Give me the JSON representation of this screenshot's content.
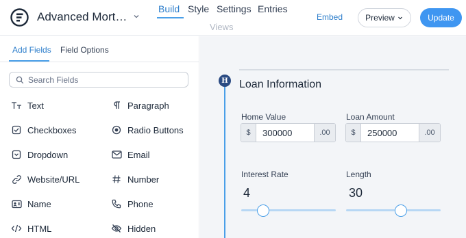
{
  "header": {
    "form_title": "Advanced Mort…",
    "tabs": [
      {
        "label": "Build"
      },
      {
        "label": "Style"
      },
      {
        "label": "Settings"
      },
      {
        "label": "Entries"
      }
    ],
    "views_label": "Views",
    "embed_label": "Embed",
    "preview_label": "Preview",
    "update_label": "Update"
  },
  "sidebar": {
    "tabs": [
      {
        "label": "Add Fields"
      },
      {
        "label": "Field Options"
      }
    ],
    "search_placeholder": "Search Fields",
    "fields": [
      {
        "label": "Text",
        "icon": "text-icon"
      },
      {
        "label": "Paragraph",
        "icon": "paragraph-icon"
      },
      {
        "label": "Checkboxes",
        "icon": "checkbox-icon"
      },
      {
        "label": "Radio Buttons",
        "icon": "radio-icon"
      },
      {
        "label": "Dropdown",
        "icon": "dropdown-icon"
      },
      {
        "label": "Email",
        "icon": "email-icon"
      },
      {
        "label": "Website/URL",
        "icon": "link-icon"
      },
      {
        "label": "Number",
        "icon": "hash-icon"
      },
      {
        "label": "Name",
        "icon": "name-card-icon"
      },
      {
        "label": "Phone",
        "icon": "phone-icon"
      },
      {
        "label": "HTML",
        "icon": "code-icon"
      },
      {
        "label": "Hidden",
        "icon": "eye-off-icon"
      }
    ]
  },
  "form": {
    "section_marker": "H",
    "section_title": "Loan Information",
    "home_value": {
      "label": "Home Value",
      "prefix": "$",
      "value": "300000",
      "suffix": ".00"
    },
    "loan_amount": {
      "label": "Loan Amount",
      "prefix": "$",
      "value": "250000",
      "suffix": ".00"
    },
    "interest_rate": {
      "label": "Interest Rate",
      "value": "4",
      "slider_fraction": 0.23
    },
    "length": {
      "label": "Length",
      "value": "30",
      "slider_fraction": 0.58
    }
  },
  "colors": {
    "accent": "#3f96f1",
    "link": "#2d7ecb",
    "marker": "#2b4b83",
    "canvas_bg": "#f3f5f8"
  }
}
